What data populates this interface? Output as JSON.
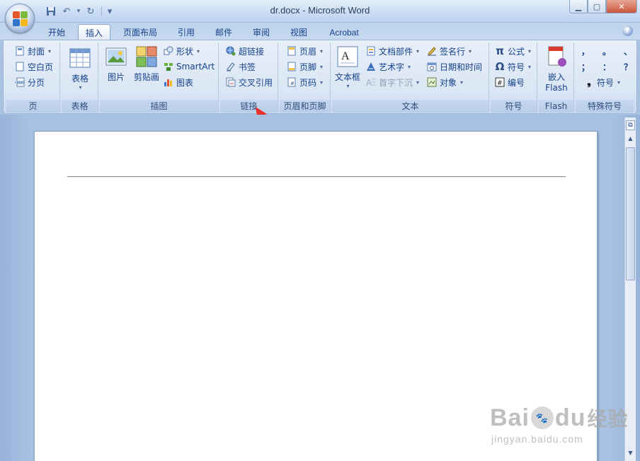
{
  "window": {
    "title": "dr.docx - Microsoft Word",
    "minimize_icon": "minimize-icon",
    "maximize_icon": "maximize-icon",
    "close_icon": "close-icon"
  },
  "quick_access": {
    "save": "💾",
    "undo": "↶",
    "redo": "↻",
    "customize": "▾"
  },
  "tabs": [
    "开始",
    "插入",
    "页面布局",
    "引用",
    "邮件",
    "审阅",
    "视图",
    "Acrobat"
  ],
  "active_tab": "插入",
  "groups": {
    "pages": {
      "label": "页",
      "cover": "封面",
      "blank": "空白页",
      "break": "分页"
    },
    "table": {
      "label": "表格",
      "table": "表格"
    },
    "illustrations": {
      "label": "插图",
      "picture": "图片",
      "clipart": "剪贴画",
      "shapes": "形状",
      "smartart": "SmartArt",
      "chart": "图表"
    },
    "links": {
      "label": "链接",
      "hyperlink": "超链接",
      "bookmark": "书签",
      "crossref": "交叉引用"
    },
    "header_footer": {
      "label": "页眉和页脚",
      "header": "页眉",
      "footer": "页脚",
      "pagenum": "页码"
    },
    "text": {
      "label": "文本",
      "textbox": "文本框",
      "quickparts": "文档部件",
      "wordart": "艺术字",
      "dropcap": "首字下沉",
      "signature": "签名行",
      "datetime": "日期和时间",
      "object": "对象"
    },
    "symbols": {
      "label": "符号",
      "equation": "公式",
      "symbol": "符号",
      "number": "编号"
    },
    "flash": {
      "label": "Flash",
      "embed_line1": "嵌入",
      "embed_line2": "Flash"
    },
    "special": {
      "label": "特殊符号",
      "chars_row1": [
        "，",
        "。",
        "、"
      ],
      "chars_row2": [
        "；",
        "：",
        "？"
      ],
      "symbol": "符号"
    }
  },
  "watermark": {
    "brand": "Bai",
    "brand2": "du",
    "brand_cn": "经验",
    "url": "jingyan.baidu.com"
  },
  "colors": {
    "accent": "#15428b",
    "ribbon": "#dbe6f4",
    "annotation": "#e8322b"
  }
}
